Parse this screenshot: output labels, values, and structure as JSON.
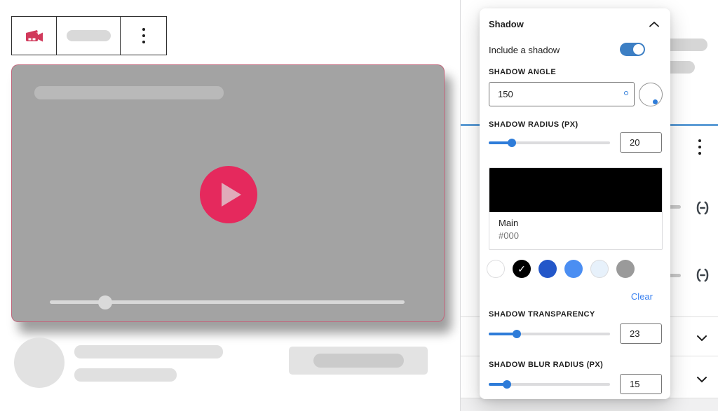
{
  "colors": {
    "brand_pink": "#d1395b",
    "play_pink": "#e5295d",
    "accent_blue": "#2e7cd9",
    "toggle_blue": "#3d7fc4",
    "link_blue": "#3b82f0",
    "tab_blue": "#5e9dd6",
    "dial_dot_blue": "#2e7cd9"
  },
  "toolbar": {
    "video_icon": "video-camera-icon",
    "more_icon": "kebab-menu-icon"
  },
  "panel": {
    "title": "Shadow",
    "toggle": {
      "label": "Include a shadow",
      "state": "on"
    },
    "angle": {
      "label": "SHADOW ANGLE",
      "value": "150"
    },
    "radius": {
      "label": "SHADOW RADIUS (PX)",
      "value": "20",
      "fill": "19%"
    },
    "swatch_preview": {
      "name": "Main",
      "hex": "#000",
      "color": "#000000"
    },
    "palette": [
      {
        "name": "white",
        "color": "#ffffff",
        "selected": false
      },
      {
        "name": "black",
        "color": "#000000",
        "selected": true
      },
      {
        "name": "dark-blue",
        "color": "#2357c9",
        "selected": false
      },
      {
        "name": "blue",
        "color": "#4b8ef2",
        "selected": false
      },
      {
        "name": "pale-blue",
        "color": "#e7f1fb",
        "selected": false
      },
      {
        "name": "gray",
        "color": "#9a9a9a",
        "selected": false
      }
    ],
    "check_glyph": "✓",
    "clear_label": "Clear",
    "transparency": {
      "label": "SHADOW TRANSPARENCY",
      "value": "23",
      "fill": "23%"
    },
    "blur": {
      "label": "SHADOW BLUR RADIUS (PX)",
      "value": "15",
      "fill": "15%"
    }
  }
}
